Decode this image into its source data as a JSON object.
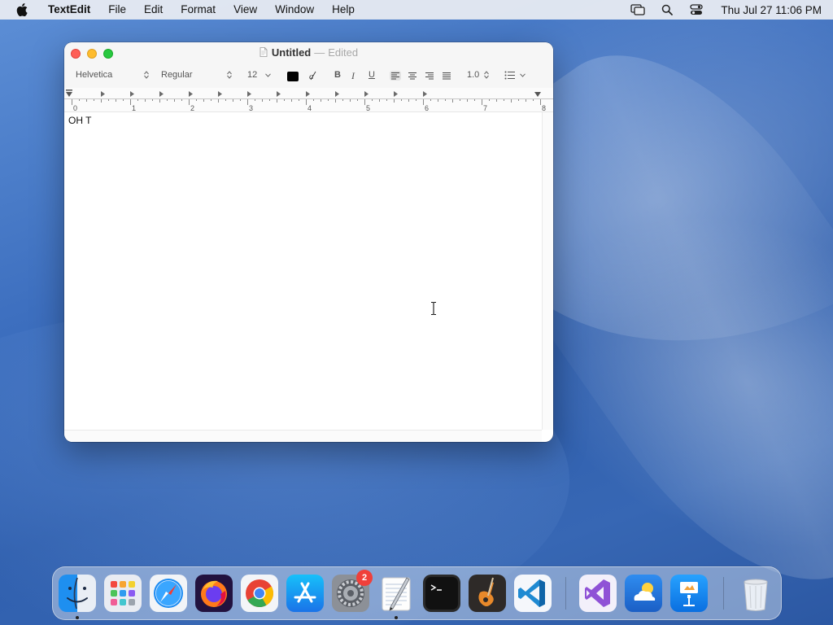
{
  "menubar": {
    "app_name": "TextEdit",
    "items": [
      "File",
      "Edit",
      "Format",
      "View",
      "Window",
      "Help"
    ],
    "clock": "Thu Jul 27  11:06 PM",
    "status_icons": [
      "screen-mirroring-icon",
      "spotlight-search-icon",
      "control-center-icon"
    ]
  },
  "window": {
    "title": "Untitled",
    "separator": "—",
    "state": "Edited",
    "toolbar": {
      "font_family": "Helvetica",
      "font_style": "Regular",
      "font_size": "12",
      "text_color": "#000000",
      "bold_label": "B",
      "italic_label": "I",
      "underline_label": "U",
      "line_spacing": "1.0",
      "active_alignment": "left"
    },
    "ruler": {
      "labels": [
        "0",
        "1",
        "2",
        "3",
        "4",
        "5",
        "6",
        "7",
        "8"
      ]
    },
    "document_text": "OH T"
  },
  "dock": {
    "apps": [
      {
        "name": "Finder",
        "icon": "finder-icon",
        "running": true
      },
      {
        "name": "Launchpad",
        "icon": "launchpad-icon",
        "running": false
      },
      {
        "name": "Safari",
        "icon": "safari-icon",
        "running": false
      },
      {
        "name": "Firefox",
        "icon": "firefox-icon",
        "running": false
      },
      {
        "name": "Chrome",
        "icon": "chrome-icon",
        "running": false
      },
      {
        "name": "App Store",
        "icon": "app-store-icon",
        "running": false
      },
      {
        "name": "System Settings",
        "icon": "system-settings-icon",
        "running": false,
        "badge": "2"
      },
      {
        "name": "TextEdit",
        "icon": "textedit-icon",
        "running": true
      },
      {
        "name": "Terminal",
        "icon": "terminal-icon",
        "running": false
      },
      {
        "name": "GarageBand",
        "icon": "garageband-icon",
        "running": false
      },
      {
        "name": "Visual Studio Code",
        "icon": "vscode-icon",
        "running": false
      },
      {
        "name": "Visual Studio",
        "icon": "visual-studio-icon",
        "running": false
      },
      {
        "name": "Weather",
        "icon": "weather-icon",
        "running": false
      },
      {
        "name": "Keynote",
        "icon": "keynote-icon",
        "running": false
      },
      {
        "name": "Trash",
        "icon": "trash-icon",
        "running": false
      }
    ],
    "badge_color": "#f0403a"
  }
}
